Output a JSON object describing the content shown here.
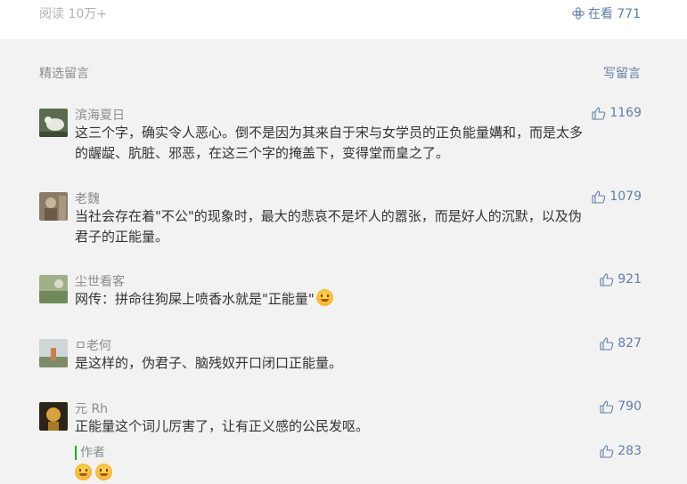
{
  "topbar": {
    "reads_label": "阅读 10万+",
    "watching_label": "在看 771"
  },
  "section": {
    "title": "精选留言",
    "write_label": "写留言"
  },
  "comments": [
    {
      "nick": "滨海夏日",
      "likes": "1169",
      "lines": [
        "这三个字，确实令人恶心。倒不是因为其来自于宋与女学员的正负能量媾和，而是太多",
        "的龌龊、肮脏、邪恶，在这三个字的掩盖下，变得堂而皇之了。"
      ]
    },
    {
      "nick": "老魏",
      "likes": "1079",
      "lines": [
        "当社会存在着\"不公\"的现象时，最大的悲哀不是坏人的嚣张，而是好人的沉默，以及伪",
        "君子的正能量。"
      ]
    },
    {
      "nick": "尘世看客",
      "likes": "921",
      "lines": [
        "网传：拼命往狗屎上喷香水就是\"正能量\""
      ]
    },
    {
      "nick": "ㅁ老何",
      "likes": "827",
      "lines": [
        "是这样的，伪君子、脑残奴开口闭口正能量。"
      ]
    },
    {
      "nick": "元 Rh",
      "likes": "790",
      "lines": [
        "正能量这个词儿厉害了，让有正义感的公民发呕。"
      ]
    }
  ],
  "author_reply": {
    "label": "作者",
    "likes": "283"
  }
}
